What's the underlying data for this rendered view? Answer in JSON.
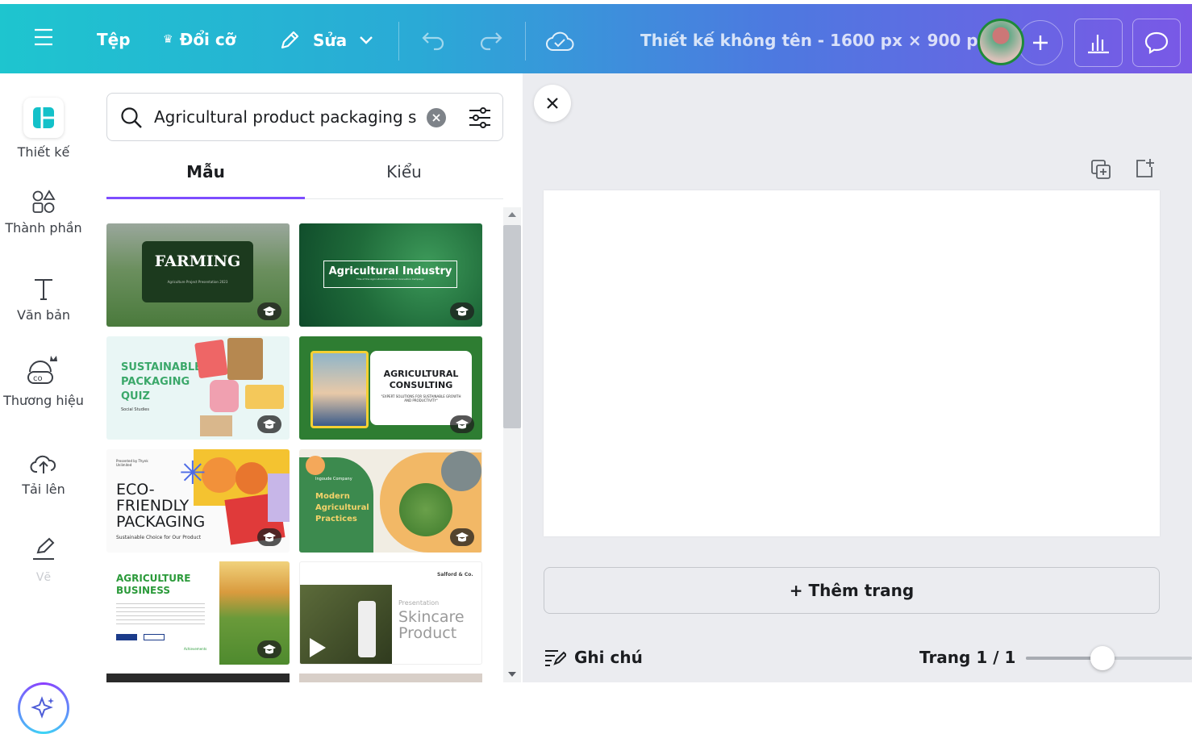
{
  "topbar": {
    "file_label": "Tệp",
    "resize_label": "Đổi cỡ",
    "edit_label": "Sửa",
    "title": "Thiết kế không tên - 1600 px × 900 px"
  },
  "rail": {
    "items": [
      {
        "label": "Thiết kế"
      },
      {
        "label": "Thành phần"
      },
      {
        "label": "Văn bản"
      },
      {
        "label": "Thương hiệu"
      },
      {
        "label": "Tải lên"
      },
      {
        "label": "Vẽ"
      }
    ]
  },
  "panel": {
    "search_value": "Agricultural product packaging s",
    "tabs": [
      {
        "label": "Mẫu"
      },
      {
        "label": "Kiểu"
      }
    ],
    "templates": [
      {
        "title": "FARMING",
        "subtitle": "Agriculture Project Presentation 2023"
      },
      {
        "title": "Agricultural Industry",
        "subtitle": "Title of the Agricultural Product or Innovation Campaign"
      },
      {
        "title": "SUSTAINABLE PACKAGING QUIZ",
        "subtitle": "Social Studies"
      },
      {
        "title": "AGRICULTURAL CONSULTING",
        "subtitle": "\"EXPERT SOLUTIONS FOR SUSTAINABLE GROWTH AND PRODUCTIVITY\""
      },
      {
        "title": "ECO-FRIENDLY PACKAGING",
        "subtitle": "Sustainable Choice for Our Product",
        "presenter": "Presented by Thynk Unlimited"
      },
      {
        "title": "Modern Agricultural Practices",
        "subtitle": "Ingoude Company"
      },
      {
        "title": "AGRICULTURE BUSINESS",
        "subtitle": "Achievements"
      },
      {
        "title": "Skincare Product",
        "subtitle": "Presentation",
        "brand": "Salford & Co."
      }
    ]
  },
  "canvas": {
    "add_page_label": "+ Thêm trang",
    "notes_label": "Ghi chú",
    "page_info": "Trang 1 / 1",
    "zoom_fraction": 0.45
  },
  "colors": {
    "accent": "#7d4dff",
    "topbar_start": "#1ec5cf",
    "topbar_end": "#7a58e6",
    "canvas_bg": "#ebecf0"
  }
}
